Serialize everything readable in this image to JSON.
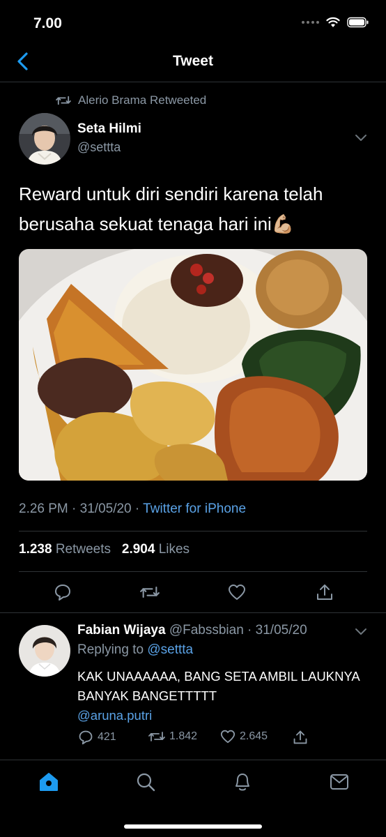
{
  "status_bar": {
    "time": "7.00"
  },
  "nav": {
    "title": "Tweet"
  },
  "retweet": {
    "label": "Alerio Brama Retweeted"
  },
  "tweet": {
    "author_name": "Seta Hilmi",
    "author_handle": "@settta",
    "text": "Reward untuk diri sendiri karena telah berusaha sekuat tenaga hari ini",
    "emoji": "💪🏼",
    "time": "2.26 PM",
    "date": "31/05/20",
    "source": "Twitter for iPhone",
    "retweets_count": "1.238",
    "retweets_label": "Retweets",
    "likes_count": "2.904",
    "likes_label": "Likes",
    "media_description": "rice plate with side dishes"
  },
  "reply": {
    "author_name": "Fabian Wijaya",
    "author_handle": "@Fabssbian",
    "date": "31/05/20",
    "replying_label": "Replying to",
    "replying_to": "@settta",
    "text": "KAK UNAAAAAA, BANG SETA AMBIL LAUKNYA BANYAK BANGETTTTT",
    "mention": "@aruna.putri",
    "reply_count": "421",
    "retweet_count": "1.842",
    "like_count": "2.645"
  },
  "colors": {
    "accent": "#1d9bf0",
    "link": "#5aa2e6",
    "muted": "#8b98a5",
    "background": "#000000"
  },
  "icons": [
    "back-chevron-icon",
    "retweet-icon",
    "chevron-down-icon",
    "reply-icon",
    "like-icon",
    "share-icon",
    "home-icon",
    "search-icon",
    "notifications-icon",
    "messages-icon"
  ]
}
